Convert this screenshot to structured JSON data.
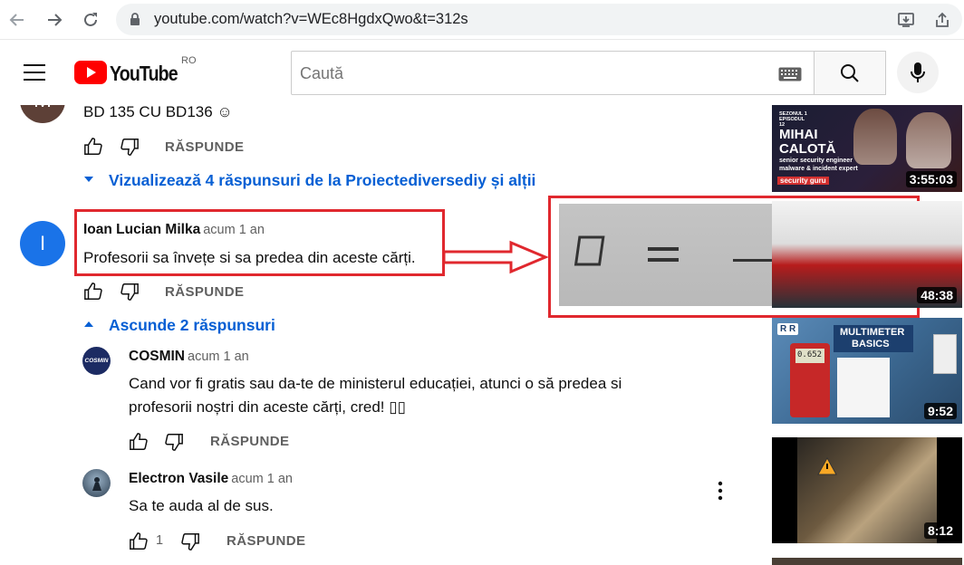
{
  "browser": {
    "url": "youtube.com/watch?v=WEc8HgdxQwo&t=312s"
  },
  "masthead": {
    "logo_text": "YouTube",
    "region": "RO",
    "search_placeholder": "Caută"
  },
  "comments": [
    {
      "avatar_letter": "M",
      "text": "BD 135 CU BD136 ☺",
      "reply_label": "RĂSPUNDE",
      "toggle_label": "Vizualizează 4 răspunsuri de la Proiectediversediy și alții"
    },
    {
      "avatar_letter": "I",
      "author": "Ioan Lucian Milka",
      "time": "acum 1 an",
      "text": "Profesorii  sa  învețe si sa  predea din aceste  cărți.",
      "reply_label": "RĂSPUNDE",
      "toggle_label": "Ascunde 2 răspunsuri",
      "replies": [
        {
          "avatar_text": "COSMIN",
          "author": "COSMIN",
          "time": "acum 1 an",
          "text_line1": "Cand vor fi gratis sau da-te de ministerul educației, atunci o să predea si",
          "text_line2": "profesorii noștri din aceste cărți, cred! ▯▯",
          "reply_label": "RĂSPUNDE"
        },
        {
          "author": "Electron Vasile",
          "time": "acum 1 an",
          "text": "Sa te auda al de sus.",
          "likes": "1",
          "reply_label": "RĂSPUNDE"
        }
      ]
    }
  ],
  "sidebar": [
    {
      "tag": "SEZONUL 1 EPISODUL 12",
      "title_line1": "MIHAI",
      "title_line2": "CALOTĂ",
      "subtitle_line1": "senior security engineer",
      "subtitle_line2": "malware & incident expert",
      "brand": "security guru",
      "duration": "3:55:03"
    },
    {
      "duration": "48:38"
    },
    {
      "badge": "R R",
      "title_line1": "MULTIMETER",
      "title_line2": "BASICS",
      "display": "0.652",
      "duration": "9:52"
    },
    {
      "duration": "8:12"
    }
  ],
  "colors": {
    "annotation_red": "#e0282e",
    "link_blue": "#065fd4",
    "youtube_red": "#ff0000",
    "avatar_brown": "#5d4037",
    "avatar_blue": "#1a73e8"
  }
}
